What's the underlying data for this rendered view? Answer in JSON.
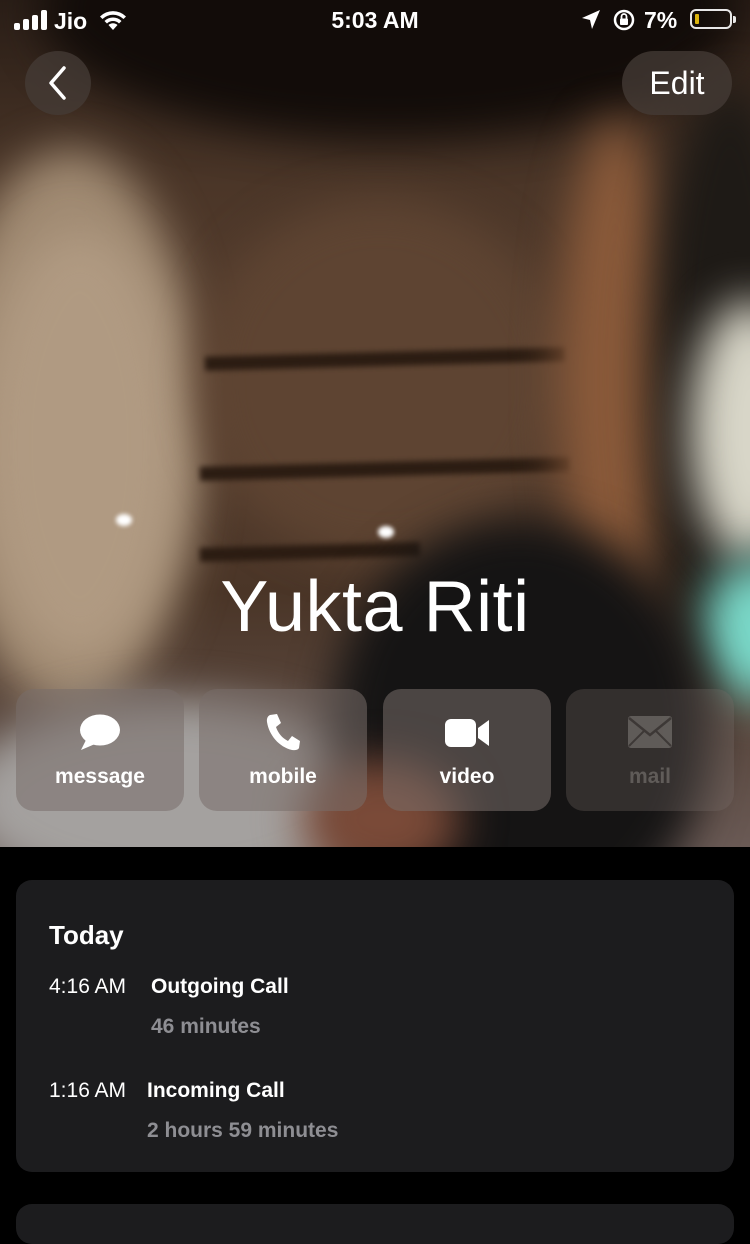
{
  "status_bar": {
    "carrier": "Jio",
    "time": "5:03 AM",
    "battery_percent": "7%",
    "battery_level": 0.07
  },
  "nav": {
    "edit_label": "Edit"
  },
  "contact": {
    "name": "Yukta Riti"
  },
  "actions": [
    {
      "label": "message",
      "icon": "message-icon",
      "enabled": true
    },
    {
      "label": "mobile",
      "icon": "phone-icon",
      "enabled": true
    },
    {
      "label": "video",
      "icon": "video-icon",
      "enabled": true
    },
    {
      "label": "mail",
      "icon": "mail-icon",
      "enabled": false
    }
  ],
  "recents": {
    "title": "Today",
    "calls": [
      {
        "time": "4:16 AM",
        "type": "Outgoing Call",
        "duration": "46 minutes"
      },
      {
        "time": "1:16 AM",
        "type": "Incoming Call",
        "duration": "2 hours 59 minutes"
      }
    ]
  },
  "colors": {
    "background": "#000000",
    "card": "#1c1c1e",
    "secondary_text": "#8e8e93",
    "battery_low": "#f2c80f"
  }
}
